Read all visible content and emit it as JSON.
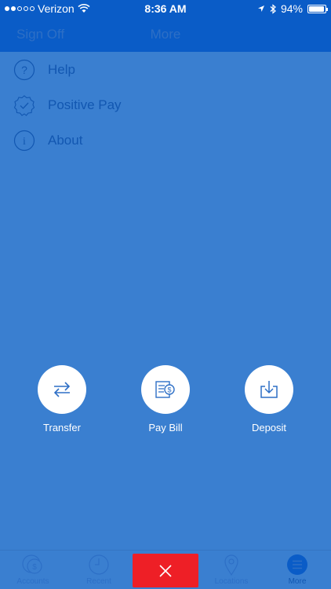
{
  "status_bar": {
    "carrier": "Verizon",
    "time": "8:36 AM",
    "battery": "94%",
    "battery_level": 0.94
  },
  "nav": {
    "sign_off": "Sign Off",
    "title": "More"
  },
  "menu": {
    "items": [
      {
        "label": "Help",
        "icon": "help-icon"
      },
      {
        "label": "Positive Pay",
        "icon": "badge-check-icon"
      },
      {
        "label": "About",
        "icon": "info-icon"
      }
    ]
  },
  "actions": {
    "items": [
      {
        "label": "Transfer",
        "icon": "transfer-icon"
      },
      {
        "label": "Pay Bill",
        "icon": "pay-bill-icon"
      },
      {
        "label": "Deposit",
        "icon": "deposit-icon"
      }
    ]
  },
  "tabs": {
    "items": [
      {
        "label": "Accounts",
        "icon": "accounts-icon"
      },
      {
        "label": "Recent",
        "icon": "clock-icon"
      },
      {
        "label": "",
        "icon": "close-icon"
      },
      {
        "label": "Locations",
        "icon": "location-pin-icon"
      },
      {
        "label": "More",
        "icon": "menu-icon"
      }
    ]
  },
  "colors": {
    "background": "#3a7fd0",
    "header": "#0a5cc7",
    "accent_text": "#1257b1",
    "close_button": "#ee1f26",
    "action_label": "#ffffff"
  }
}
